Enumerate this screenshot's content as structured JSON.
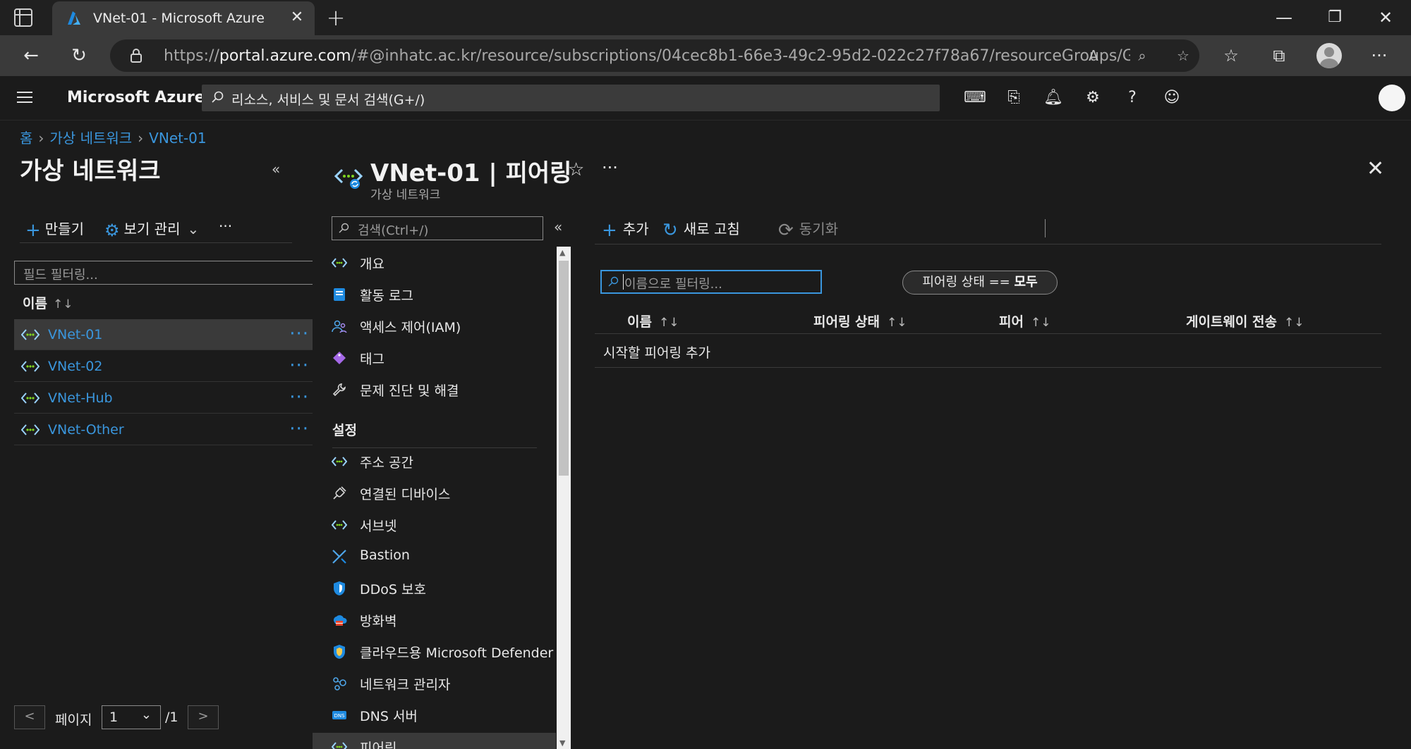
{
  "browser": {
    "tab_title": "VNet-01 - Microsoft Azure",
    "url_prefix": "https://",
    "url_host": "portal.azure.com",
    "url_rest": "/#@inhatc.ac.kr/resource/subscriptions/04cec8b1-66e3-49c2-95d2-022c27f78a67/resourceGroups/Group/p..."
  },
  "azure": {
    "brand": "Microsoft Azure",
    "search_placeholder": "리소스, 서비스 및 문서 검색(G+/)"
  },
  "breadcrumb": [
    "홈",
    "가상 네트워크",
    "VNet-01"
  ],
  "left_blade": {
    "title": "가상 네트워크",
    "commands": {
      "create": "만들기",
      "manage_view": "보기 관리",
      "more": "···"
    },
    "filter_placeholder": "필드 필터링...",
    "column_name": "이름",
    "sort_glyph": "↑↓",
    "items": [
      {
        "name": "VNet-01"
      },
      {
        "name": "VNet-02"
      },
      {
        "name": "VNet-Hub"
      },
      {
        "name": "VNet-Other"
      }
    ],
    "pager": {
      "prev": "<",
      "label": "페이지",
      "value": "1",
      "total": "/1",
      "next": ">"
    }
  },
  "blade": {
    "title": "VNet-01 | 피어링",
    "subtitle": "가상 네트워크",
    "menu_search_placeholder": "검색(Ctrl+/)",
    "menu_top": [
      {
        "label": "개요",
        "icon": "vnet-icon"
      },
      {
        "label": "활동 로그",
        "icon": "activity-log-icon"
      },
      {
        "label": "액세스 제어(IAM)",
        "icon": "iam-icon"
      },
      {
        "label": "태그",
        "icon": "tag-icon"
      },
      {
        "label": "문제 진단 및 해결",
        "icon": "wrench-icon"
      }
    ],
    "menu_section": "설정",
    "menu_settings": [
      {
        "label": "주소 공간",
        "icon": "vnet-icon"
      },
      {
        "label": "연결된 디바이스",
        "icon": "plug-icon"
      },
      {
        "label": "서브넷",
        "icon": "vnet-icon"
      },
      {
        "label": "Bastion",
        "icon": "bastion-icon"
      },
      {
        "label": "DDoS 보호",
        "icon": "shield-icon"
      },
      {
        "label": "방화벽",
        "icon": "firewall-icon"
      },
      {
        "label": "클라우드용 Microsoft Defender",
        "icon": "defender-icon"
      },
      {
        "label": "네트워크 관리자",
        "icon": "network-manager-icon"
      },
      {
        "label": "DNS 서버",
        "icon": "dns-icon"
      },
      {
        "label": "피어링",
        "icon": "vnet-icon"
      }
    ],
    "commands": {
      "add": "추가",
      "refresh": "새로 고침",
      "sync": "동기화"
    },
    "filter_placeholder": "이름으로 필터링...",
    "pill_prefix": "피어링 상태 ==",
    "pill_value": "모두",
    "columns": [
      "이름",
      "피어링 상태",
      "피어",
      "게이트웨이 전송"
    ],
    "sort_glyph": "↑↓",
    "empty_message": "시작할 피어링 추가"
  },
  "colors": {
    "accent": "#3a96dd",
    "background": "#1b1b1b",
    "selected_row": "#3a3a3a"
  }
}
